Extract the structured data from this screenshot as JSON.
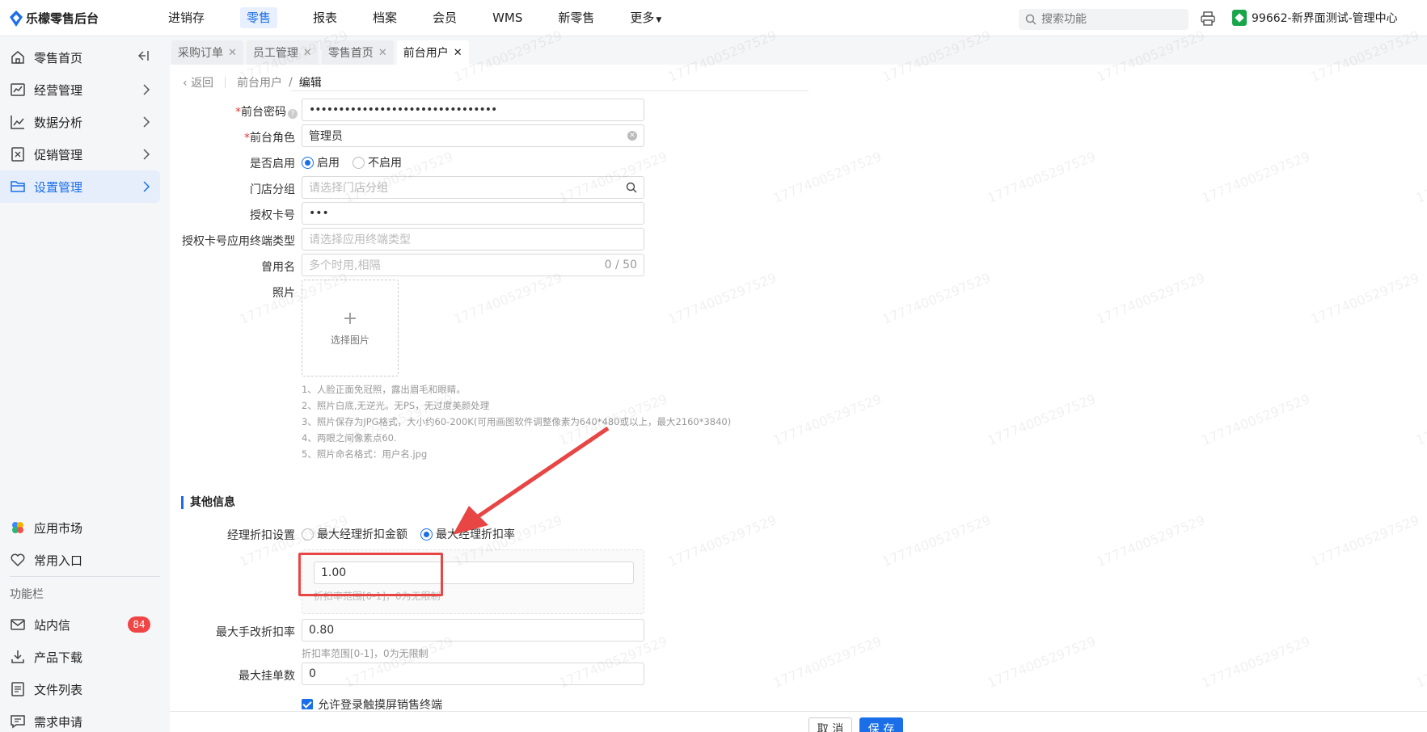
{
  "app": {
    "title": "乐檬零售后台"
  },
  "topnav": [
    "进销存",
    "零售",
    "报表",
    "档案",
    "会员",
    "WMS",
    "新零售",
    "更多"
  ],
  "search": {
    "placeholder": "搜索功能"
  },
  "store": {
    "name": "99662-新界面测试-管理中心"
  },
  "sidebar": {
    "items": [
      {
        "label": "零售首页",
        "icon": "home-icon"
      },
      {
        "label": "经营管理",
        "icon": "chart-icon"
      },
      {
        "label": "数据分析",
        "icon": "trend-icon"
      },
      {
        "label": "促销管理",
        "icon": "promo-icon"
      },
      {
        "label": "设置管理",
        "icon": "folder-icon"
      }
    ],
    "bottom_items": [
      {
        "label": "应用市场",
        "icon": "app-market-icon"
      },
      {
        "label": "常用入口",
        "icon": "heart-icon"
      }
    ],
    "section_label": "功能栏",
    "func_items": [
      {
        "label": "站内信",
        "icon": "mail-icon",
        "badge": "84"
      },
      {
        "label": "产品下载",
        "icon": "download-icon"
      },
      {
        "label": "文件列表",
        "icon": "file-list-icon"
      },
      {
        "label": "需求申请",
        "icon": "request-icon"
      }
    ]
  },
  "tabs": [
    {
      "label": "采购订单"
    },
    {
      "label": "员工管理"
    },
    {
      "label": "零售首页"
    },
    {
      "label": "前台用户"
    }
  ],
  "breadcrumb": {
    "back": "返回",
    "parent": "前台用户",
    "sep": "/",
    "current": "编辑"
  },
  "form": {
    "password": {
      "label": "前台密码",
      "value": "••••••••••••••••••••••••••••••••"
    },
    "role": {
      "label": "前台角色",
      "value": "管理员"
    },
    "enabled": {
      "label": "是否启用",
      "opt_on": "启用",
      "opt_off": "不启用"
    },
    "store_group": {
      "label": "门店分组",
      "placeholder": "请选择门店分组"
    },
    "auth_card": {
      "label": "授权卡号",
      "value": "•••"
    },
    "terminal_type": {
      "label": "授权卡号应用终端类型",
      "placeholder": "请选择应用终端类型"
    },
    "alias": {
      "label": "曾用名",
      "placeholder": "多个时用,相隔",
      "counter": "0 / 50"
    },
    "photo": {
      "label": "照片",
      "upload_text": "选择图片"
    },
    "tips": [
      "1、人脸正面免冠照，露出眉毛和眼睛。",
      "2、照片白底,无逆光。无PS，无过度美颜处理",
      "3、照片保存为JPG格式，大小约60-200K(可用画图软件调整像素为640*480或以上，最大2160*3840)",
      "4、两眼之间像素点60.",
      "5、照片命名格式：用户名.jpg"
    ],
    "section_other": "其他信息",
    "manager_discount": {
      "label": "经理折扣设置",
      "opt_amount": "最大经理折扣金额",
      "opt_rate": "最大经理折扣率",
      "value": "1.00",
      "hint": "折扣率范围[0-1]，0为无限制"
    },
    "max_manual_discount": {
      "label": "最大手改折扣率",
      "value": "0.80",
      "hint": "折扣率范围[0-1]，0为无限制"
    },
    "max_hold": {
      "label": "最大挂单数",
      "value": "0"
    },
    "allow_touch": {
      "label": "允许登录触摸屏销售终端"
    }
  },
  "footer": {
    "cancel": "取 消",
    "save": "保 存"
  },
  "watermark": "17774005297529"
}
